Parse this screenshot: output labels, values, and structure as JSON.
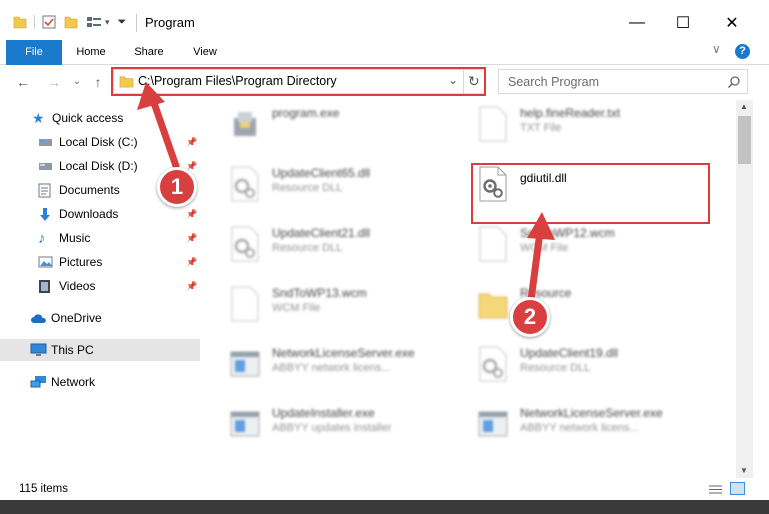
{
  "window": {
    "title": "Program",
    "minimize": "—",
    "maximize": "☐",
    "close": "✕"
  },
  "ribbon": {
    "tabs": [
      {
        "label": "File"
      },
      {
        "label": "Home"
      },
      {
        "label": "Share"
      },
      {
        "label": "View"
      }
    ],
    "expand_glyph": "∨",
    "help_glyph": "?"
  },
  "address": {
    "path": "C:\\Program Files\\Program Directory",
    "dropdown_glyph": "⌄",
    "refresh_glyph": "↻",
    "back_glyph": "←",
    "forward_glyph": "→",
    "recent_glyph": "⌄",
    "up_glyph": "↑"
  },
  "search": {
    "placeholder": "Search Program",
    "icon": "search-icon"
  },
  "sidebar": {
    "items": [
      {
        "label": "Quick access",
        "icon": "star-icon",
        "pinned": false
      },
      {
        "label": "Local Disk (C:)",
        "icon": "drive-icon",
        "pinned": true
      },
      {
        "label": "Local Disk (D:)",
        "icon": "drive-icon",
        "pinned": true
      },
      {
        "label": "Documents",
        "icon": "documents-icon",
        "pinned": true
      },
      {
        "label": "Downloads",
        "icon": "downloads-icon",
        "pinned": true
      },
      {
        "label": "Music",
        "icon": "music-icon",
        "pinned": true
      },
      {
        "label": "Pictures",
        "icon": "pictures-icon",
        "pinned": true
      },
      {
        "label": "Videos",
        "icon": "videos-icon",
        "pinned": true
      },
      {
        "label": "OneDrive",
        "icon": "cloud-icon",
        "pinned": false
      },
      {
        "label": "This PC",
        "icon": "pc-icon",
        "pinned": false,
        "selected": true
      },
      {
        "label": "Network",
        "icon": "network-icon",
        "pinned": false
      }
    ],
    "pin_glyph": "📌"
  },
  "files": {
    "left": [
      {
        "name": "program.exe",
        "type": "",
        "icon": "program-exe-icon"
      },
      {
        "name": "UpdateClient65.dll",
        "type": "Resource DLL",
        "icon": "dll-gear-icon"
      },
      {
        "name": "UpdateClient21.dll",
        "type": "Resource DLL",
        "icon": "dll-gear-icon"
      },
      {
        "name": "SndToWP13.wcm",
        "type": "WCM File",
        "icon": "blank-file-icon"
      },
      {
        "name": "NetworkLicenseServer.exe",
        "type": "ABBYY network licens...",
        "icon": "exe-window-icon"
      },
      {
        "name": "UpdateInstaller.exe",
        "type": "ABBYY updates installer",
        "icon": "exe-window-icon"
      }
    ],
    "right": [
      {
        "name": "help.fineReader.txt",
        "type": "TXT File",
        "icon": "text-file-icon"
      },
      {
        "name": "gdiutil.dll",
        "type": "",
        "icon": "dll-gear-icon",
        "highlighted": true
      },
      {
        "name": "SndToWP12.wcm",
        "type": "WCM File",
        "icon": "blank-file-icon"
      },
      {
        "name": "Resource",
        "type": "",
        "icon": "folder-icon"
      },
      {
        "name": "UpdateClient19.dll",
        "type": "Resource DLL",
        "icon": "dll-gear-icon"
      },
      {
        "name": "NetworkLicenseServer.exe",
        "type": "ABBYY network licens...",
        "icon": "exe-window-icon"
      }
    ]
  },
  "status": {
    "count": "115 items"
  },
  "annotations": {
    "step1": "1",
    "step2": "2",
    "color": "#d84040"
  },
  "colors": {
    "accent": "#1979ca",
    "folder": "#f2c94c"
  }
}
